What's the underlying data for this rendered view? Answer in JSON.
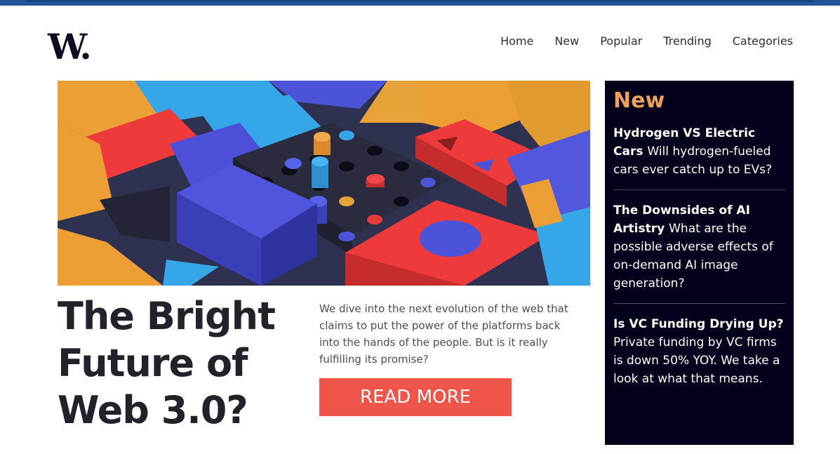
{
  "site": {
    "logo_text": "W."
  },
  "nav": {
    "items": [
      "Home",
      "New",
      "Popular",
      "Trending",
      "Categories"
    ]
  },
  "hero": {
    "image_icon": "abstract-3d-blocks-illustration",
    "title_lines": [
      "The Bright",
      "Future of",
      "Web 3.0?"
    ],
    "teaser": "We dive into the next evolution of the web that claims to put the power of the platforms back into the hands of the people. But is it really fulfilling its promise?",
    "cta_label": "READ MORE"
  },
  "sidebar": {
    "title": "New",
    "items": [
      {
        "title": "Hydrogen VS Electric Cars",
        "desc": "Will hydrogen-fueled cars ever catch up to EVs?"
      },
      {
        "title": "The Downsides of AI Artistry",
        "desc": "What are the possible adverse effects of on-demand AI image generation?"
      },
      {
        "title": "Is VC Funding Drying Up?",
        "desc": "Private funding by VC firms is down 50% YOY. We take a look at what that means."
      }
    ]
  },
  "colors": {
    "accent": "#f0554a",
    "sidebar_bg": "#03001b",
    "sidebar_title": "#f0a157",
    "top_bar": "#21569a",
    "headline": "#22232a"
  }
}
